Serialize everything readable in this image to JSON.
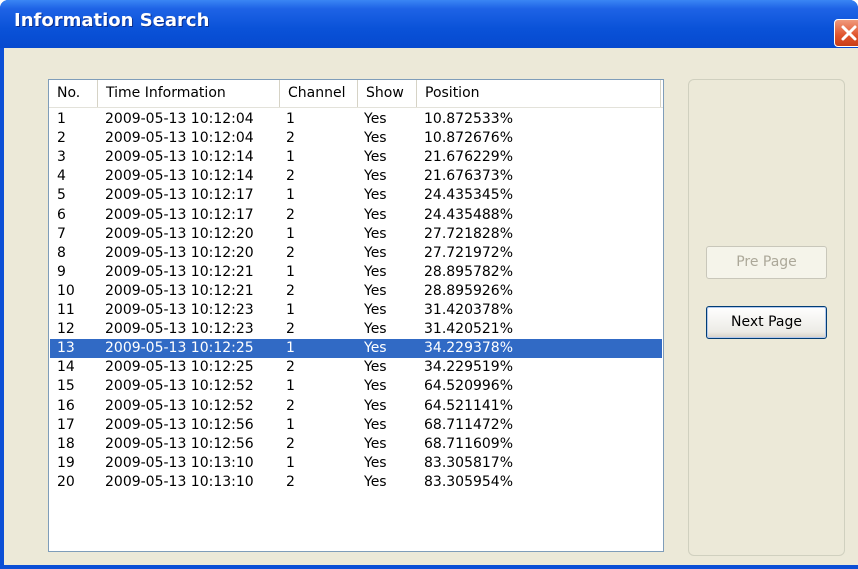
{
  "window": {
    "title": "Information Search",
    "close_icon": "close-icon"
  },
  "columns": [
    "No.",
    "Time Information",
    "Channel",
    "Show",
    "Position"
  ],
  "rows": [
    {
      "no": "1",
      "time": "2009-05-13 10:12:04",
      "channel": "1",
      "show": "Yes",
      "position": "10.872533%"
    },
    {
      "no": "2",
      "time": "2009-05-13 10:12:04",
      "channel": "2",
      "show": "Yes",
      "position": "10.872676%"
    },
    {
      "no": "3",
      "time": "2009-05-13 10:12:14",
      "channel": "1",
      "show": "Yes",
      "position": "21.676229%"
    },
    {
      "no": "4",
      "time": "2009-05-13 10:12:14",
      "channel": "2",
      "show": "Yes",
      "position": "21.676373%"
    },
    {
      "no": "5",
      "time": "2009-05-13 10:12:17",
      "channel": "1",
      "show": "Yes",
      "position": "24.435345%"
    },
    {
      "no": "6",
      "time": "2009-05-13 10:12:17",
      "channel": "2",
      "show": "Yes",
      "position": "24.435488%"
    },
    {
      "no": "7",
      "time": "2009-05-13 10:12:20",
      "channel": "1",
      "show": "Yes",
      "position": "27.721828%"
    },
    {
      "no": "8",
      "time": "2009-05-13 10:12:20",
      "channel": "2",
      "show": "Yes",
      "position": "27.721972%"
    },
    {
      "no": "9",
      "time": "2009-05-13 10:12:21",
      "channel": "1",
      "show": "Yes",
      "position": "28.895782%"
    },
    {
      "no": "10",
      "time": "2009-05-13 10:12:21",
      "channel": "2",
      "show": "Yes",
      "position": "28.895926%"
    },
    {
      "no": "11",
      "time": "2009-05-13 10:12:23",
      "channel": "1",
      "show": "Yes",
      "position": "31.420378%"
    },
    {
      "no": "12",
      "time": "2009-05-13 10:12:23",
      "channel": "2",
      "show": "Yes",
      "position": "31.420521%"
    },
    {
      "no": "13",
      "time": "2009-05-13 10:12:25",
      "channel": "1",
      "show": "Yes",
      "position": "34.229378%",
      "selected": true
    },
    {
      "no": "14",
      "time": "2009-05-13 10:12:25",
      "channel": "2",
      "show": "Yes",
      "position": "34.229519%"
    },
    {
      "no": "15",
      "time": "2009-05-13 10:12:52",
      "channel": "1",
      "show": "Yes",
      "position": "64.520996%"
    },
    {
      "no": "16",
      "time": "2009-05-13 10:12:52",
      "channel": "2",
      "show": "Yes",
      "position": "64.521141%"
    },
    {
      "no": "17",
      "time": "2009-05-13 10:12:56",
      "channel": "1",
      "show": "Yes",
      "position": "68.711472%"
    },
    {
      "no": "18",
      "time": "2009-05-13 10:12:56",
      "channel": "2",
      "show": "Yes",
      "position": "68.711609%"
    },
    {
      "no": "19",
      "time": "2009-05-13 10:13:10",
      "channel": "1",
      "show": "Yes",
      "position": "83.305817%"
    },
    {
      "no": "20",
      "time": "2009-05-13 10:13:10",
      "channel": "2",
      "show": "Yes",
      "position": "83.305954%"
    }
  ],
  "buttons": {
    "pre_page": "Pre Page",
    "next_page": "Next Page"
  },
  "colors": {
    "titlebar": "#0a52d8",
    "selection": "#316ac5",
    "dialog_bg": "#ece9d8"
  }
}
